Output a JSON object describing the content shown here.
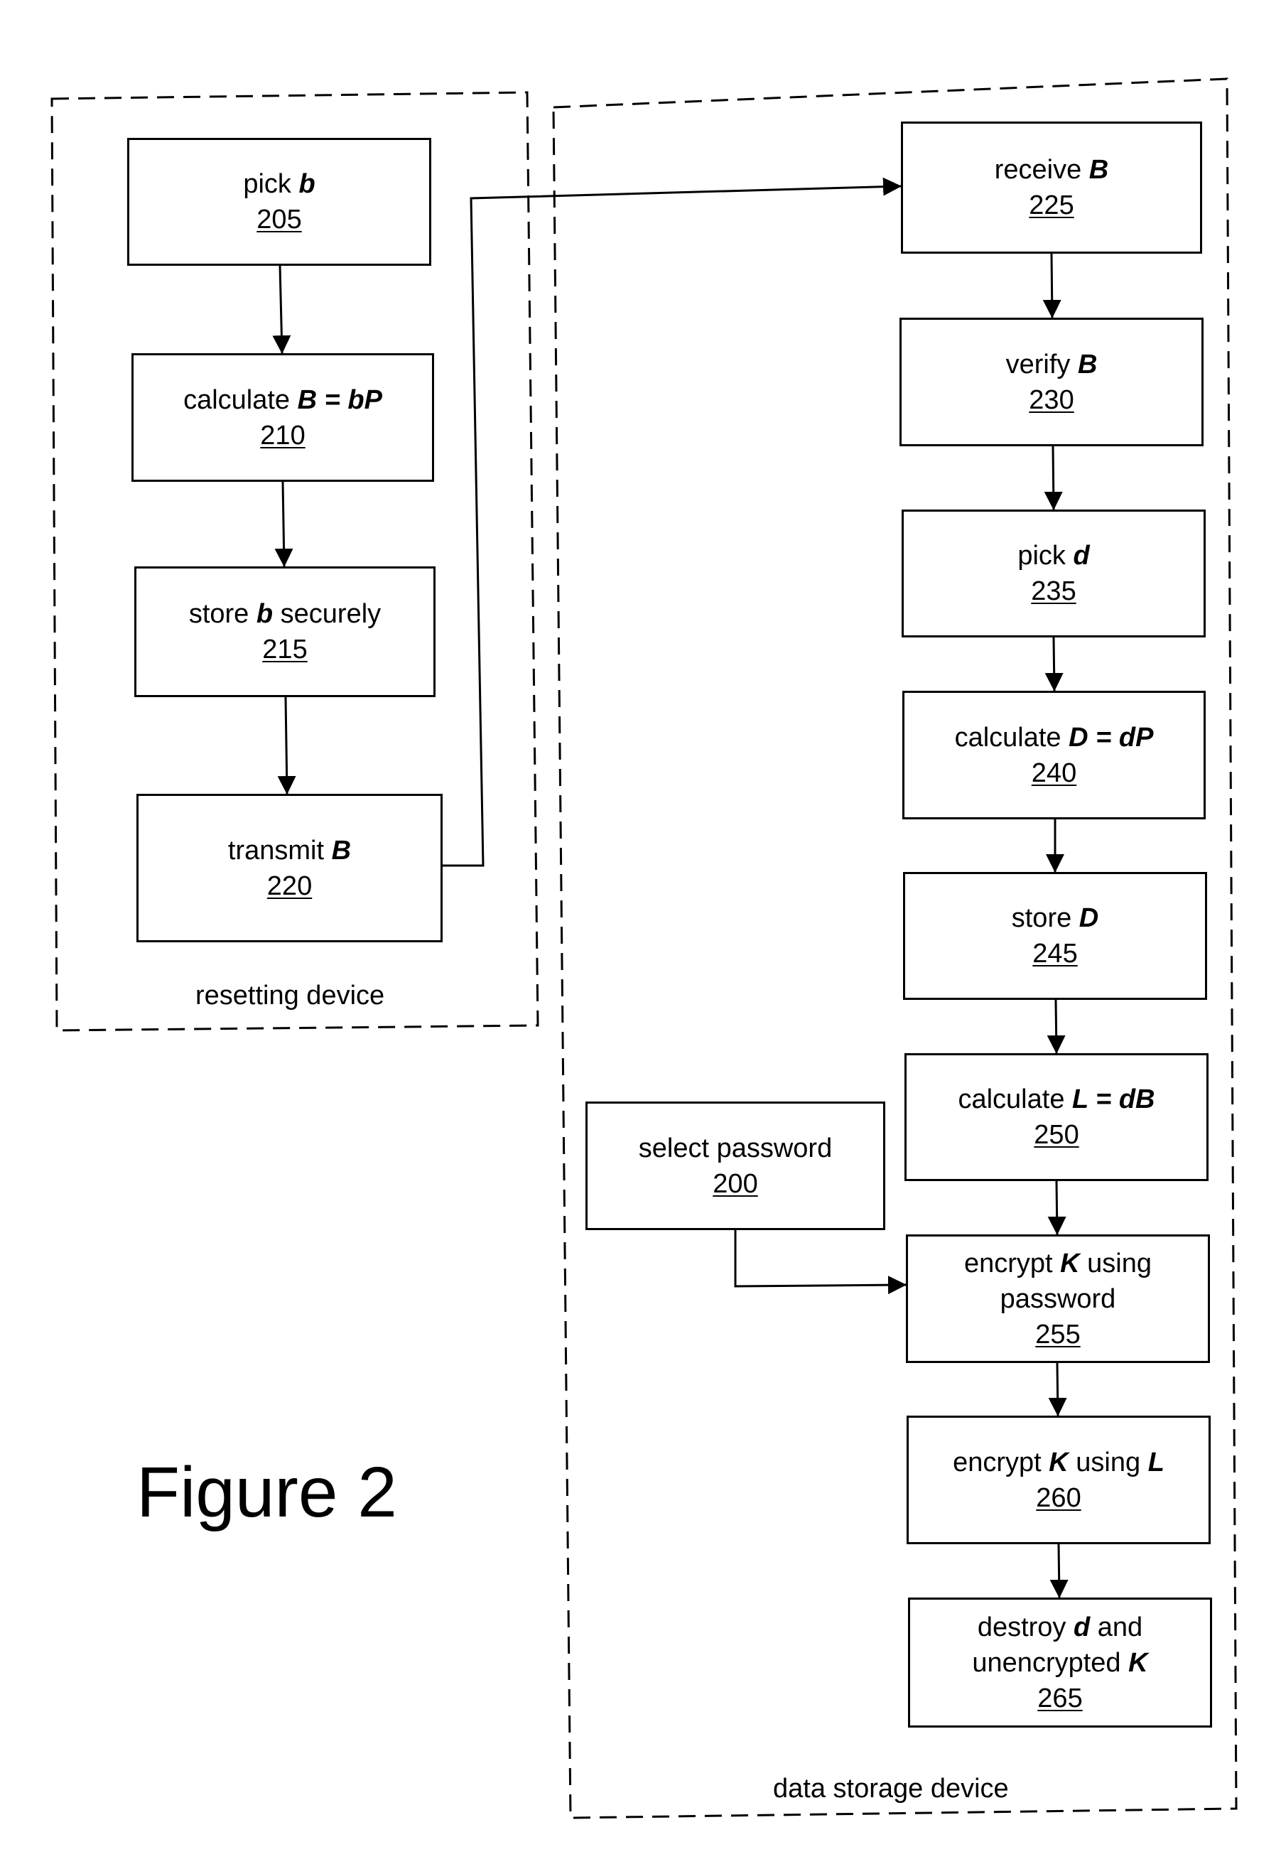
{
  "figure": {
    "title": "Figure 2"
  },
  "groups": {
    "resetting_device": {
      "label": "resetting device"
    },
    "data_storage_device": {
      "label": "data storage device"
    }
  },
  "steps": {
    "s205": {
      "parts": [
        {
          "t": "pick "
        },
        {
          "t": "b",
          "math": true
        }
      ],
      "number": "205"
    },
    "s210": {
      "parts": [
        {
          "t": "calculate "
        },
        {
          "t": "B = bP",
          "math": true
        }
      ],
      "number": "210"
    },
    "s215": {
      "parts": [
        {
          "t": "store "
        },
        {
          "t": "b",
          "math": true
        },
        {
          "t": " securely"
        }
      ],
      "number": "215"
    },
    "s220": {
      "parts": [
        {
          "t": "transmit "
        },
        {
          "t": "B",
          "math": true
        }
      ],
      "number": "220"
    },
    "s225": {
      "parts": [
        {
          "t": "receive "
        },
        {
          "t": "B",
          "math": true
        }
      ],
      "number": "225"
    },
    "s230": {
      "parts": [
        {
          "t": "verify "
        },
        {
          "t": "B",
          "math": true
        }
      ],
      "number": "230"
    },
    "s235": {
      "parts": [
        {
          "t": "pick "
        },
        {
          "t": "d",
          "math": true
        }
      ],
      "number": "235"
    },
    "s240": {
      "parts": [
        {
          "t": "calculate "
        },
        {
          "t": "D = dP",
          "math": true
        }
      ],
      "number": "240"
    },
    "s245": {
      "parts": [
        {
          "t": "store "
        },
        {
          "t": "D",
          "math": true
        }
      ],
      "number": "245"
    },
    "s250": {
      "parts": [
        {
          "t": "calculate "
        },
        {
          "t": "L = dB",
          "math": true
        }
      ],
      "number": "250"
    },
    "s200": {
      "parts": [
        {
          "t": "select password"
        }
      ],
      "number": "200"
    },
    "s255": {
      "lines": [
        [
          {
            "t": "encrypt "
          },
          {
            "t": "K",
            "math": true
          },
          {
            "t": " using"
          }
        ],
        [
          {
            "t": "password"
          }
        ]
      ],
      "number": "255"
    },
    "s260": {
      "parts": [
        {
          "t": "encrypt "
        },
        {
          "t": "K",
          "math": true
        },
        {
          "t": " using "
        },
        {
          "t": "L",
          "math": true
        }
      ],
      "number": "260"
    },
    "s265": {
      "lines": [
        [
          {
            "t": "destroy "
          },
          {
            "t": "d",
            "math": true
          },
          {
            "t": " and"
          }
        ],
        [
          {
            "t": "unencrypted "
          },
          {
            "t": "K",
            "math": true
          }
        ]
      ],
      "number": "265"
    }
  },
  "flows": [
    {
      "from": "205",
      "to": "210"
    },
    {
      "from": "210",
      "to": "215"
    },
    {
      "from": "215",
      "to": "220"
    },
    {
      "from": "220",
      "to": "225"
    },
    {
      "from": "225",
      "to": "230"
    },
    {
      "from": "230",
      "to": "235"
    },
    {
      "from": "235",
      "to": "240"
    },
    {
      "from": "240",
      "to": "245"
    },
    {
      "from": "245",
      "to": "250"
    },
    {
      "from": "250",
      "to": "255"
    },
    {
      "from": "200",
      "to": "255"
    },
    {
      "from": "255",
      "to": "260"
    },
    {
      "from": "260",
      "to": "265"
    }
  ]
}
